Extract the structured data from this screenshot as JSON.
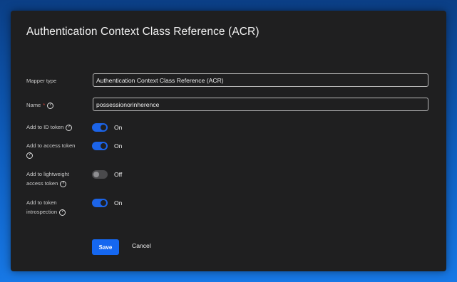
{
  "dialog": {
    "title": "Authentication Context Class Reference (ACR)"
  },
  "form": {
    "mapper_type": {
      "label": "Mapper type",
      "value": "Authentication Context Class Reference (ACR)"
    },
    "name": {
      "label": "Name",
      "required_mark": "*",
      "value": "possessionorinherence"
    },
    "toggles": [
      {
        "label_line1": "Add to ID token",
        "label_line2": "",
        "state": "On",
        "enabled": true
      },
      {
        "label_line1": "Add to access token",
        "label_line2": "",
        "state": "On",
        "enabled": true
      },
      {
        "label_line1": "Add to lightweight",
        "label_line2": "access token",
        "state": "Off",
        "enabled": false
      },
      {
        "label_line1": "Add to token",
        "label_line2": "introspection",
        "state": "On",
        "enabled": true
      }
    ],
    "help_glyph": "?"
  },
  "actions": {
    "save_label": "Save",
    "cancel_label": "Cancel"
  },
  "colors": {
    "primary": "#1567f0",
    "switch_on": "#1c64e8",
    "switch_off": "#4a4a4c",
    "required": "#e0433a",
    "panel_bg": "#1f1f20"
  }
}
